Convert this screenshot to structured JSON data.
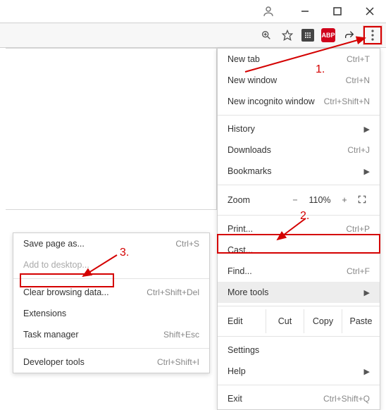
{
  "title_bar": {
    "profile": "profile"
  },
  "toolbar": {
    "abp_label": "ABP"
  },
  "main_menu": {
    "new_tab": {
      "label": "New tab",
      "shortcut": "Ctrl+T"
    },
    "new_window": {
      "label": "New window",
      "shortcut": "Ctrl+N"
    },
    "new_incognito": {
      "label": "New incognito window",
      "shortcut": "Ctrl+Shift+N"
    },
    "history": {
      "label": "History"
    },
    "downloads": {
      "label": "Downloads",
      "shortcut": "Ctrl+J"
    },
    "bookmarks": {
      "label": "Bookmarks"
    },
    "zoom": {
      "label": "Zoom",
      "minus": "−",
      "value": "110%",
      "plus": "+"
    },
    "print": {
      "label": "Print...",
      "shortcut": "Ctrl+P"
    },
    "cast": {
      "label": "Cast..."
    },
    "find": {
      "label": "Find...",
      "shortcut": "Ctrl+F"
    },
    "more_tools": {
      "label": "More tools"
    },
    "edit": {
      "label": "Edit",
      "cut": "Cut",
      "copy": "Copy",
      "paste": "Paste"
    },
    "settings": {
      "label": "Settings"
    },
    "help": {
      "label": "Help"
    },
    "exit": {
      "label": "Exit",
      "shortcut": "Ctrl+Shift+Q"
    }
  },
  "sub_menu": {
    "save_page": {
      "label": "Save page as...",
      "shortcut": "Ctrl+S"
    },
    "add_desktop": {
      "label": "Add to desktop..."
    },
    "clear_data": {
      "label": "Clear browsing data...",
      "shortcut": "Ctrl+Shift+Del"
    },
    "extensions": {
      "label": "Extensions"
    },
    "task_manager": {
      "label": "Task manager",
      "shortcut": "Shift+Esc"
    },
    "dev_tools": {
      "label": "Developer tools",
      "shortcut": "Ctrl+Shift+I"
    }
  },
  "annotations": {
    "a1": "1.",
    "a2": "2.",
    "a3": "3."
  }
}
